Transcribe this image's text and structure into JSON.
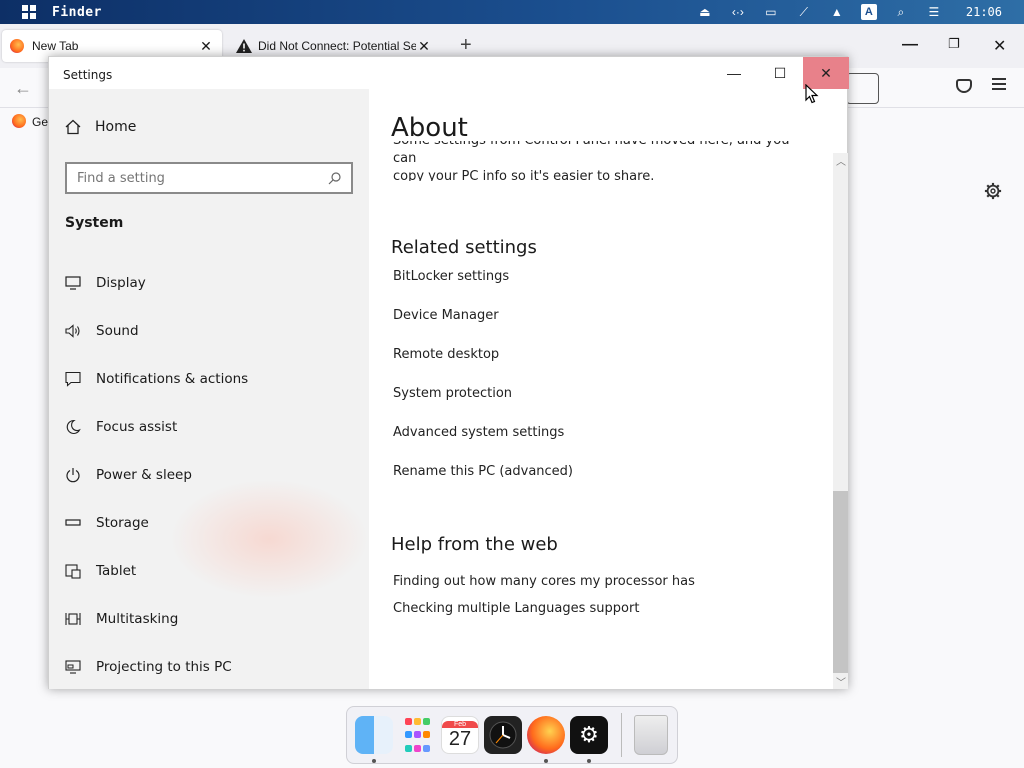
{
  "topbar": {
    "app_name": "Finder",
    "clock": "21:06",
    "keyboard_indicator": "A"
  },
  "browser": {
    "tabs": [
      {
        "label": "New Tab",
        "icon": "firefox-icon"
      },
      {
        "label": "Did Not Connect: Potential Security Issue",
        "icon": "warning-icon"
      }
    ],
    "bookmark_label": "Get"
  },
  "settings": {
    "window_title": "Settings",
    "home_label": "Home",
    "search_placeholder": "Find a setting",
    "section_heading": "System",
    "nav_items": [
      {
        "label": "Display",
        "icon": "display-icon"
      },
      {
        "label": "Sound",
        "icon": "sound-icon"
      },
      {
        "label": "Notifications & actions",
        "icon": "notifications-icon"
      },
      {
        "label": "Focus assist",
        "icon": "moon-icon"
      },
      {
        "label": "Power & sleep",
        "icon": "power-icon"
      },
      {
        "label": "Storage",
        "icon": "storage-icon"
      },
      {
        "label": "Tablet",
        "icon": "tablet-icon"
      },
      {
        "label": "Multitasking",
        "icon": "multitasking-icon"
      },
      {
        "label": "Projecting to this PC",
        "icon": "projecting-icon"
      }
    ],
    "content": {
      "title": "About",
      "intro_line1": "Some settings from Control Panel have moved here, and you can",
      "intro_line2": "copy your PC info so it's easier to share.",
      "related_heading": "Related settings",
      "related_links": [
        "BitLocker settings",
        "Device Manager",
        "Remote desktop",
        "System protection",
        "Advanced system settings",
        "Rename this PC (advanced)"
      ],
      "help_heading": "Help from the web",
      "help_links": [
        "Finding out how many cores my processor has",
        "Checking multiple Languages support"
      ]
    }
  },
  "dock": {
    "calendar_month": "Feb",
    "calendar_day": "27",
    "apps": [
      "finder-icon",
      "launchpad-icon",
      "calendar-icon",
      "clock-icon",
      "firefox-icon",
      "settings-icon",
      "trash-icon"
    ]
  },
  "colors": {
    "close_hover": "#e8818a",
    "topbar_start": "#0d2f66",
    "sidebar_bg": "#f2f2f2"
  }
}
